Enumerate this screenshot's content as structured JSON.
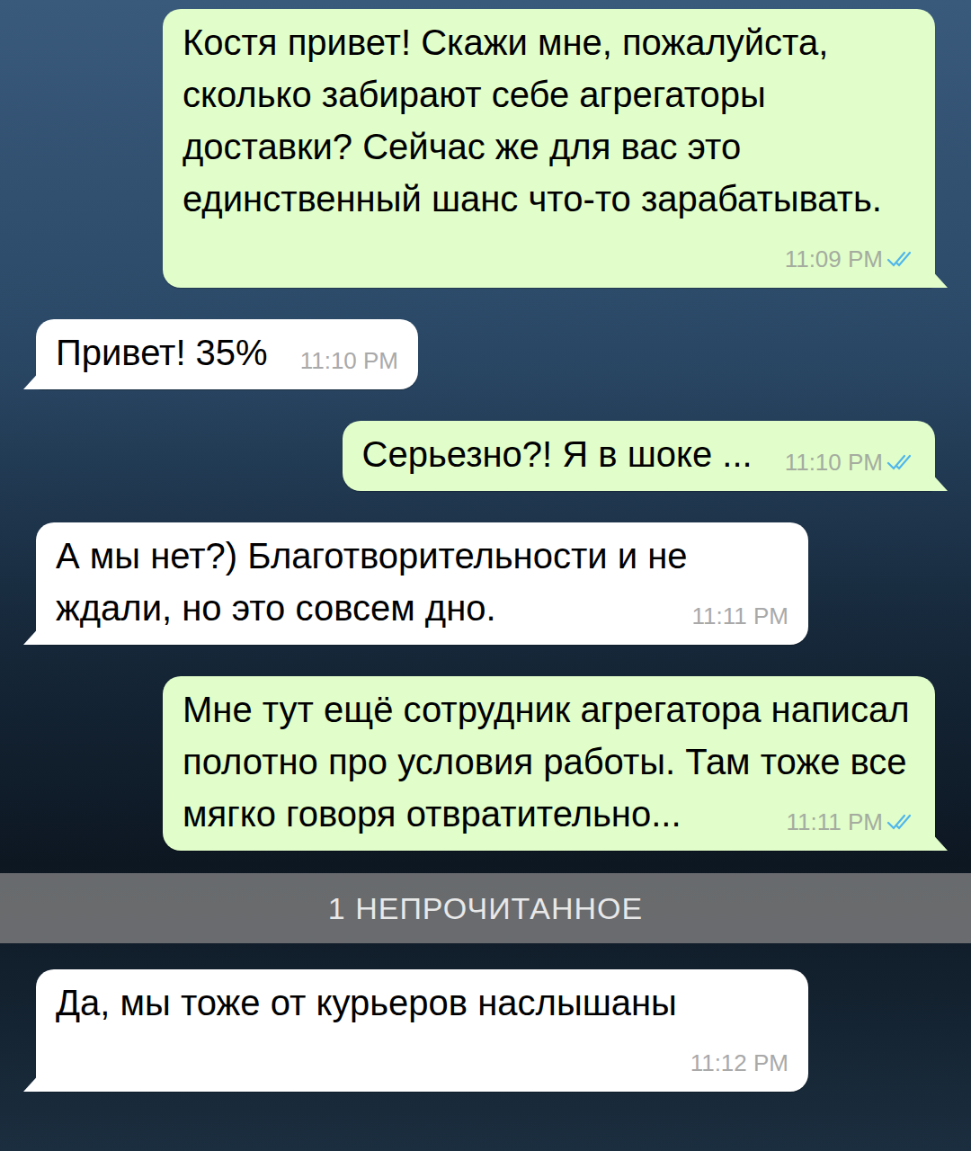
{
  "chat": {
    "items": [
      {
        "kind": "out",
        "text": "Костя привет! Скажи мне, пожалуйста, сколько забирают себе агрегаторы доставки? Сейчас же для вас это единственный шанс что-то зарабатывать.",
        "time": "11:09 PM",
        "read": true
      },
      {
        "kind": "in",
        "text": "Привет! 35%",
        "time": "11:10 PM"
      },
      {
        "kind": "out",
        "text": "Серьезно?! Я в шоке ...",
        "time": "11:10 PM",
        "read": true
      },
      {
        "kind": "in",
        "text": "А мы нет?) Благотворительности и не ждали, но это совсем дно.",
        "time": "11:11 PM"
      },
      {
        "kind": "out",
        "text": "Мне тут ещё сотрудник агрегатора написал полотно про условия работы. Там тоже все мягко говоря отвратительно...",
        "time": "11:11 PM",
        "read": true
      },
      {
        "kind": "divider",
        "text": "1 НЕПРОЧИТАННОЕ"
      },
      {
        "kind": "in",
        "text": "Да, мы тоже от курьеров наслышаны",
        "time": "11:12 PM"
      }
    ]
  }
}
